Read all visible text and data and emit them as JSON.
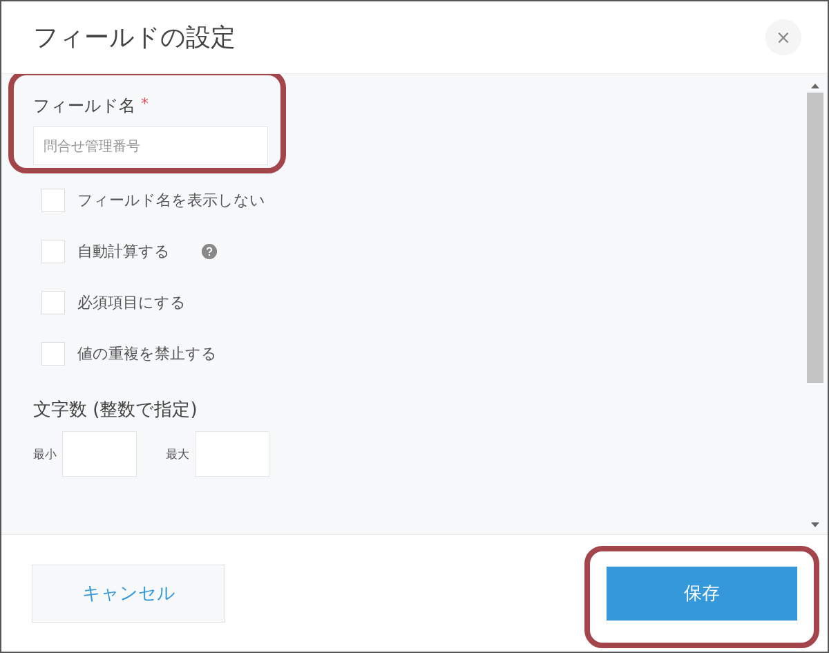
{
  "dialog": {
    "title": "フィールドの設定",
    "close": "×"
  },
  "field_name": {
    "label": "フィールド名",
    "required_mark": "*",
    "value": "問合せ管理番号",
    "highlighted": true
  },
  "options": [
    {
      "label": "フィールド名を表示しない",
      "checked": false,
      "help": false
    },
    {
      "label": "自動計算する",
      "checked": false,
      "help": true
    },
    {
      "label": "必須項目にする",
      "checked": false,
      "help": false
    },
    {
      "label": "値の重複を禁止する",
      "checked": false,
      "help": false
    }
  ],
  "length": {
    "label": "文字数 (整数で指定)",
    "min_label": "最小",
    "max_label": "最大"
  },
  "buttons": [
    {
      "label": "キャンセル",
      "kind": "secondary",
      "highlighted": false
    },
    {
      "label": "保存",
      "kind": "primary",
      "highlighted": true
    }
  ]
}
